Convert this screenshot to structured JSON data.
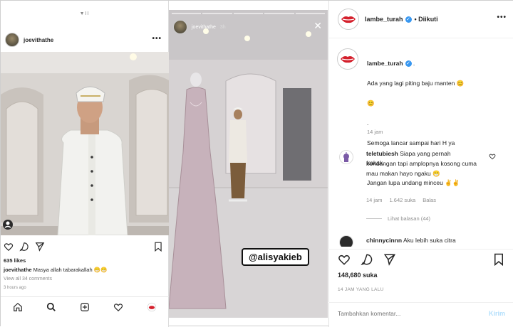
{
  "left_post": {
    "status_tiny": "▼II",
    "username": "joevithathe",
    "likes": "635 likes",
    "caption_user": "joevithathe",
    "caption_text": " Masya allah tabarakallah 😁😁",
    "view_comments": "View all 34 comments",
    "time_ago": "3 hours ago"
  },
  "story": {
    "username": "joevithathe",
    "time": "3h",
    "tag": "@alisyakieb"
  },
  "right_post": {
    "username": "lambe_turah",
    "follow_status": "• Diikuti",
    "caption_user": "lambe_turah",
    "caption_lines": [
      ".",
      "Ada yang lagi piting baju manten 😊",
      "😊",
      ".",
      "Semoga lancar sampai hari H ya",
      "kakak..",
      "Jangan lupa undang minceu ✌✌"
    ],
    "caption_time": "14 jam",
    "comment1_user": "teletubiesh",
    "comment1_text": "Siapa yang pernah kondangan tapi amplopnya kosong cuma mau makan hayo ngaku 😁",
    "comment1_time": "14 jam",
    "comment1_likes": "1.642 suka",
    "comment1_reply": "Balas",
    "view_replies": "Lihat balasan (44)",
    "comment2_user": "chinnycinnn",
    "comment2_text": "Aku lebih suka citra",
    "likes": "148,680 suka",
    "time_ago": "14 JAM YANG LALU",
    "comment_placeholder": "Tambahkan komentar...",
    "send_label": "Kirim"
  },
  "colors": {
    "verified": "#3897f0",
    "send": "#b2dffc",
    "lips": "#d4202c"
  }
}
